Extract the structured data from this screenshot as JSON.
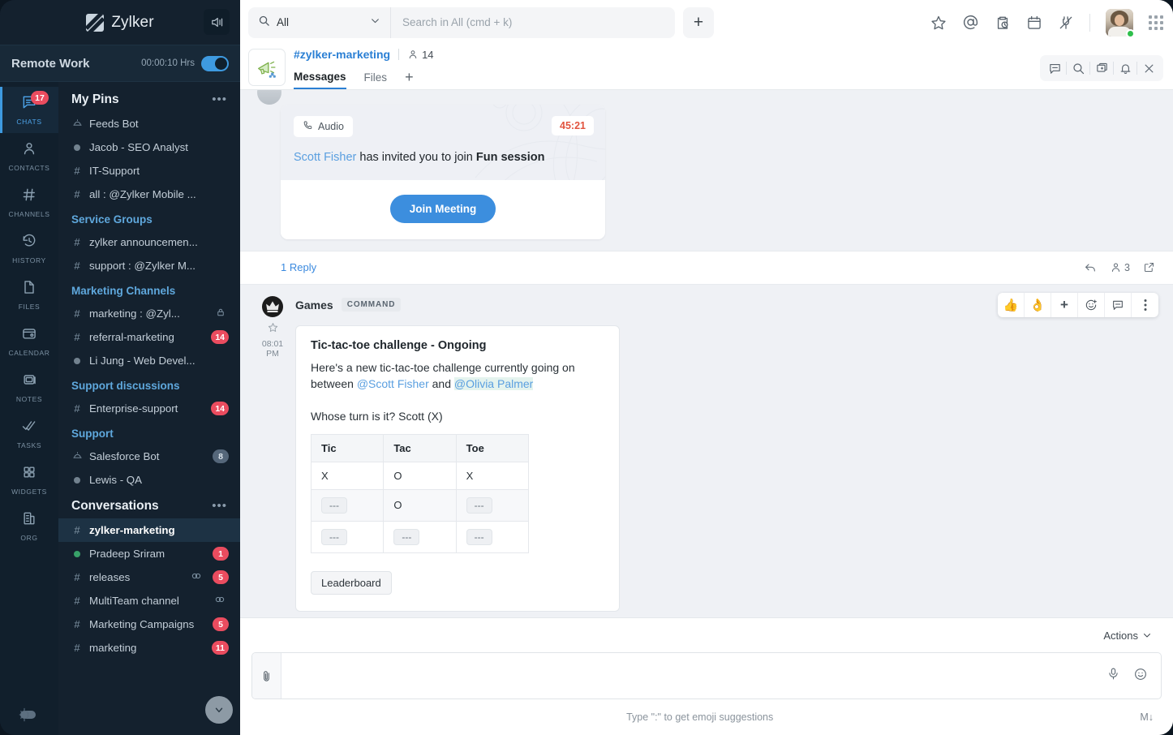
{
  "brand": {
    "name": "Zylker",
    "logo_icon": "zylker-logo-icon",
    "speaker_icon": "speaker-icon"
  },
  "status": {
    "title": "Remote Work",
    "timer": "00:00:10 Hrs",
    "toggle_on": true
  },
  "rail": {
    "items": [
      {
        "label": "CHATS",
        "icon": "chats-icon",
        "badge": "17",
        "active": true
      },
      {
        "label": "CONTACTS",
        "icon": "contacts-icon",
        "badge": "",
        "active": false
      },
      {
        "label": "CHANNELS",
        "icon": "channels-hash-icon",
        "badge": "",
        "active": false
      },
      {
        "label": "HISTORY",
        "icon": "history-clock-icon",
        "badge": "",
        "active": false
      },
      {
        "label": "FILES",
        "icon": "files-document-icon",
        "badge": "",
        "active": false
      },
      {
        "label": "CALENDAR",
        "icon": "calendar-icon",
        "badge": "",
        "active": false
      },
      {
        "label": "NOTES",
        "icon": "notes-icon",
        "badge": "",
        "active": false
      },
      {
        "label": "TASKS",
        "icon": "tasks-checks-icon",
        "badge": "",
        "active": false
      },
      {
        "label": "WIDGETS",
        "icon": "widgets-grid-icon",
        "badge": "",
        "active": false
      },
      {
        "label": "ORG",
        "icon": "org-building-icon",
        "badge": "",
        "active": false
      }
    ],
    "theme_toggle_icon": "light-dark-mode-icon"
  },
  "sidebar": {
    "groups": [
      {
        "title": "My Pins",
        "collapsible_menu": "•••",
        "is_main": true,
        "items": [
          {
            "glyph": "bot",
            "name": "Feeds Bot",
            "badge": "",
            "selected": false,
            "lock": false,
            "link": false,
            "presence": ""
          },
          {
            "glyph": "dot",
            "name": "Jacob -  SEO Analyst",
            "badge": "",
            "selected": false,
            "lock": false,
            "link": false,
            "presence": "offline"
          },
          {
            "glyph": "hash",
            "name": "IT-Support",
            "badge": "",
            "selected": false,
            "lock": false,
            "link": false,
            "presence": ""
          },
          {
            "glyph": "hash",
            "name": "all : @Zylker Mobile ...",
            "badge": "",
            "selected": false,
            "lock": false,
            "link": false,
            "presence": ""
          }
        ]
      },
      {
        "title": "Service Groups",
        "is_main": false,
        "items": [
          {
            "glyph": "hash",
            "name": "zylker announcemen...",
            "badge": "",
            "selected": false,
            "lock": false,
            "link": false,
            "presence": ""
          },
          {
            "glyph": "hash",
            "name": "support : @Zylker M...",
            "badge": "",
            "selected": false,
            "lock": false,
            "link": false,
            "presence": ""
          }
        ]
      },
      {
        "title": "Marketing Channels",
        "is_main": false,
        "items": [
          {
            "glyph": "hash",
            "name": "marketing : @Zyl...",
            "badge": "",
            "selected": false,
            "lock": true,
            "link": false,
            "presence": ""
          },
          {
            "glyph": "hash",
            "name": "referral-marketing",
            "badge": "14",
            "selected": false,
            "lock": false,
            "link": false,
            "presence": ""
          },
          {
            "glyph": "dot",
            "name": "Li Jung - Web Devel...",
            "badge": "",
            "selected": false,
            "lock": false,
            "link": false,
            "presence": "offline"
          }
        ]
      },
      {
        "title": "Support discussions",
        "is_main": false,
        "items": [
          {
            "glyph": "hash",
            "name": "Enterprise-support",
            "badge": "14",
            "selected": false,
            "lock": false,
            "link": false,
            "presence": ""
          }
        ]
      },
      {
        "title": "Support",
        "is_main": false,
        "items": [
          {
            "glyph": "bot",
            "name": "Salesforce Bot",
            "badge": "8",
            "badge_muted": true,
            "selected": false,
            "lock": false,
            "link": false,
            "presence": ""
          },
          {
            "glyph": "dot",
            "name": "Lewis - QA",
            "badge": "",
            "selected": false,
            "lock": false,
            "link": false,
            "presence": "offline"
          }
        ]
      },
      {
        "title": "Conversations",
        "collapsible_menu": "•••",
        "is_main": true,
        "items": [
          {
            "glyph": "hash",
            "name": "zylker-marketing",
            "badge": "",
            "selected": true,
            "lock": false,
            "link": false,
            "presence": ""
          },
          {
            "glyph": "dot",
            "name": "Pradeep Sriram",
            "badge": "1",
            "selected": false,
            "lock": false,
            "link": false,
            "presence": "online"
          },
          {
            "glyph": "hash",
            "name": "releases",
            "badge": "5",
            "selected": false,
            "lock": false,
            "link": true,
            "presence": ""
          },
          {
            "glyph": "hash",
            "name": "MultiTeam channel",
            "badge": "",
            "selected": false,
            "lock": false,
            "link": true,
            "presence": ""
          },
          {
            "glyph": "hash",
            "name": "Marketing Campaigns",
            "badge": "5",
            "selected": false,
            "lock": false,
            "link": false,
            "presence": ""
          },
          {
            "glyph": "hash",
            "name": "marketing",
            "badge": "11",
            "selected": false,
            "lock": false,
            "link": false,
            "presence": ""
          }
        ]
      }
    ],
    "scroll_down_icon": "chevron-down-icon"
  },
  "topbar": {
    "search_scope": "All",
    "search_scope_icon": "search-icon",
    "search_scope_chevron": "chevron-down-icon",
    "search_placeholder": "Search in All (cmd + k)",
    "search_value": "",
    "add_button": "+",
    "icons": [
      {
        "name": "star-icon"
      },
      {
        "name": "mentions-at-icon"
      },
      {
        "name": "reminders-clipboard-clock-icon"
      },
      {
        "name": "calendar-icon"
      },
      {
        "name": "integrations-plug-icon"
      }
    ],
    "avatar_presence": "online",
    "apps_grid_icon": "apps-grid-icon"
  },
  "channel": {
    "avatar_icon": "megaphone-icon",
    "name": "#zylker-marketing",
    "member_icon": "members-icon",
    "member_count": "14",
    "tabs": [
      {
        "label": "Messages",
        "active": true
      },
      {
        "label": "Files",
        "active": false
      }
    ],
    "tab_add": "+",
    "tools": [
      {
        "name": "chat-bubble-icon"
      },
      {
        "name": "search-icon"
      },
      {
        "name": "new-window-icon"
      },
      {
        "name": "bell-icon"
      },
      {
        "name": "close-icon"
      }
    ]
  },
  "messages": {
    "audio_card": {
      "badge_icon": "phone-icon",
      "badge_label": "Audio",
      "timer": "45:21",
      "inviter": "Scott Fisher",
      "text_middle": " has invited you to join ",
      "session_name": "Fun session",
      "join_label": "Join Meeting"
    },
    "reply_bar": {
      "reply_label": "1 Reply",
      "reply_arrow_icon": "reply-arrow-icon",
      "participants_icon": "participants-icon",
      "participants_count": "3",
      "open_icon": "open-external-icon"
    },
    "games": {
      "avatar_icon": "games-crown-icon",
      "star_icon": "star-outline-icon",
      "time": "08:01 PM",
      "sender": "Games",
      "tag": "COMMAND",
      "card": {
        "title": "Tic-tac-toe challenge - Ongoing",
        "desc_part1": "Here's a new tic-tac-toe challenge currently going on between ",
        "mention1": "@Scott Fisher",
        "desc_part2": " and ",
        "mention2": "@Olivia Palmer",
        "turn_text": "Whose turn is it? Scott (X)",
        "leaderboard_label": "Leaderboard"
      },
      "hover_tools": [
        {
          "name": "thumbs-up-reaction",
          "glyph": "👍"
        },
        {
          "name": "ok-hand-reaction",
          "glyph": "👌"
        },
        {
          "name": "add-reaction-plus",
          "glyph": "+"
        },
        {
          "name": "emoji-picker-icon",
          "glyph": ""
        },
        {
          "name": "reply-in-thread-icon",
          "glyph": ""
        },
        {
          "name": "more-options-icon",
          "glyph": ""
        }
      ]
    }
  },
  "chart_data": {
    "type": "table",
    "title": "Tic-tac-toe challenge - Ongoing",
    "columns": [
      "Tic",
      "Tac",
      "Toe"
    ],
    "rows": [
      [
        "X",
        "O",
        "X"
      ],
      [
        "---",
        "O",
        "---"
      ],
      [
        "---",
        "---",
        "---"
      ]
    ]
  },
  "composer": {
    "actions_label": "Actions",
    "actions_chevron": "chevron-down-icon",
    "attach_icon": "paperclip-icon",
    "input_value": "",
    "input_placeholder": "",
    "mic_icon": "microphone-icon",
    "emoji_icon": "emoji-smiley-icon",
    "hint": "Type \":\" to get emoji suggestions",
    "markdown_indicator": "M↓"
  },
  "colors": {
    "sidebar_bg": "#14212e",
    "rail_bg": "#111f2c",
    "accent_blue": "#3c8ede",
    "badge_red": "#ea4c5f",
    "group_title": "#5fa8dd",
    "selected_row": "#1d3244",
    "message_bg": "#eff1f5",
    "timer_red": "#e2543f"
  }
}
